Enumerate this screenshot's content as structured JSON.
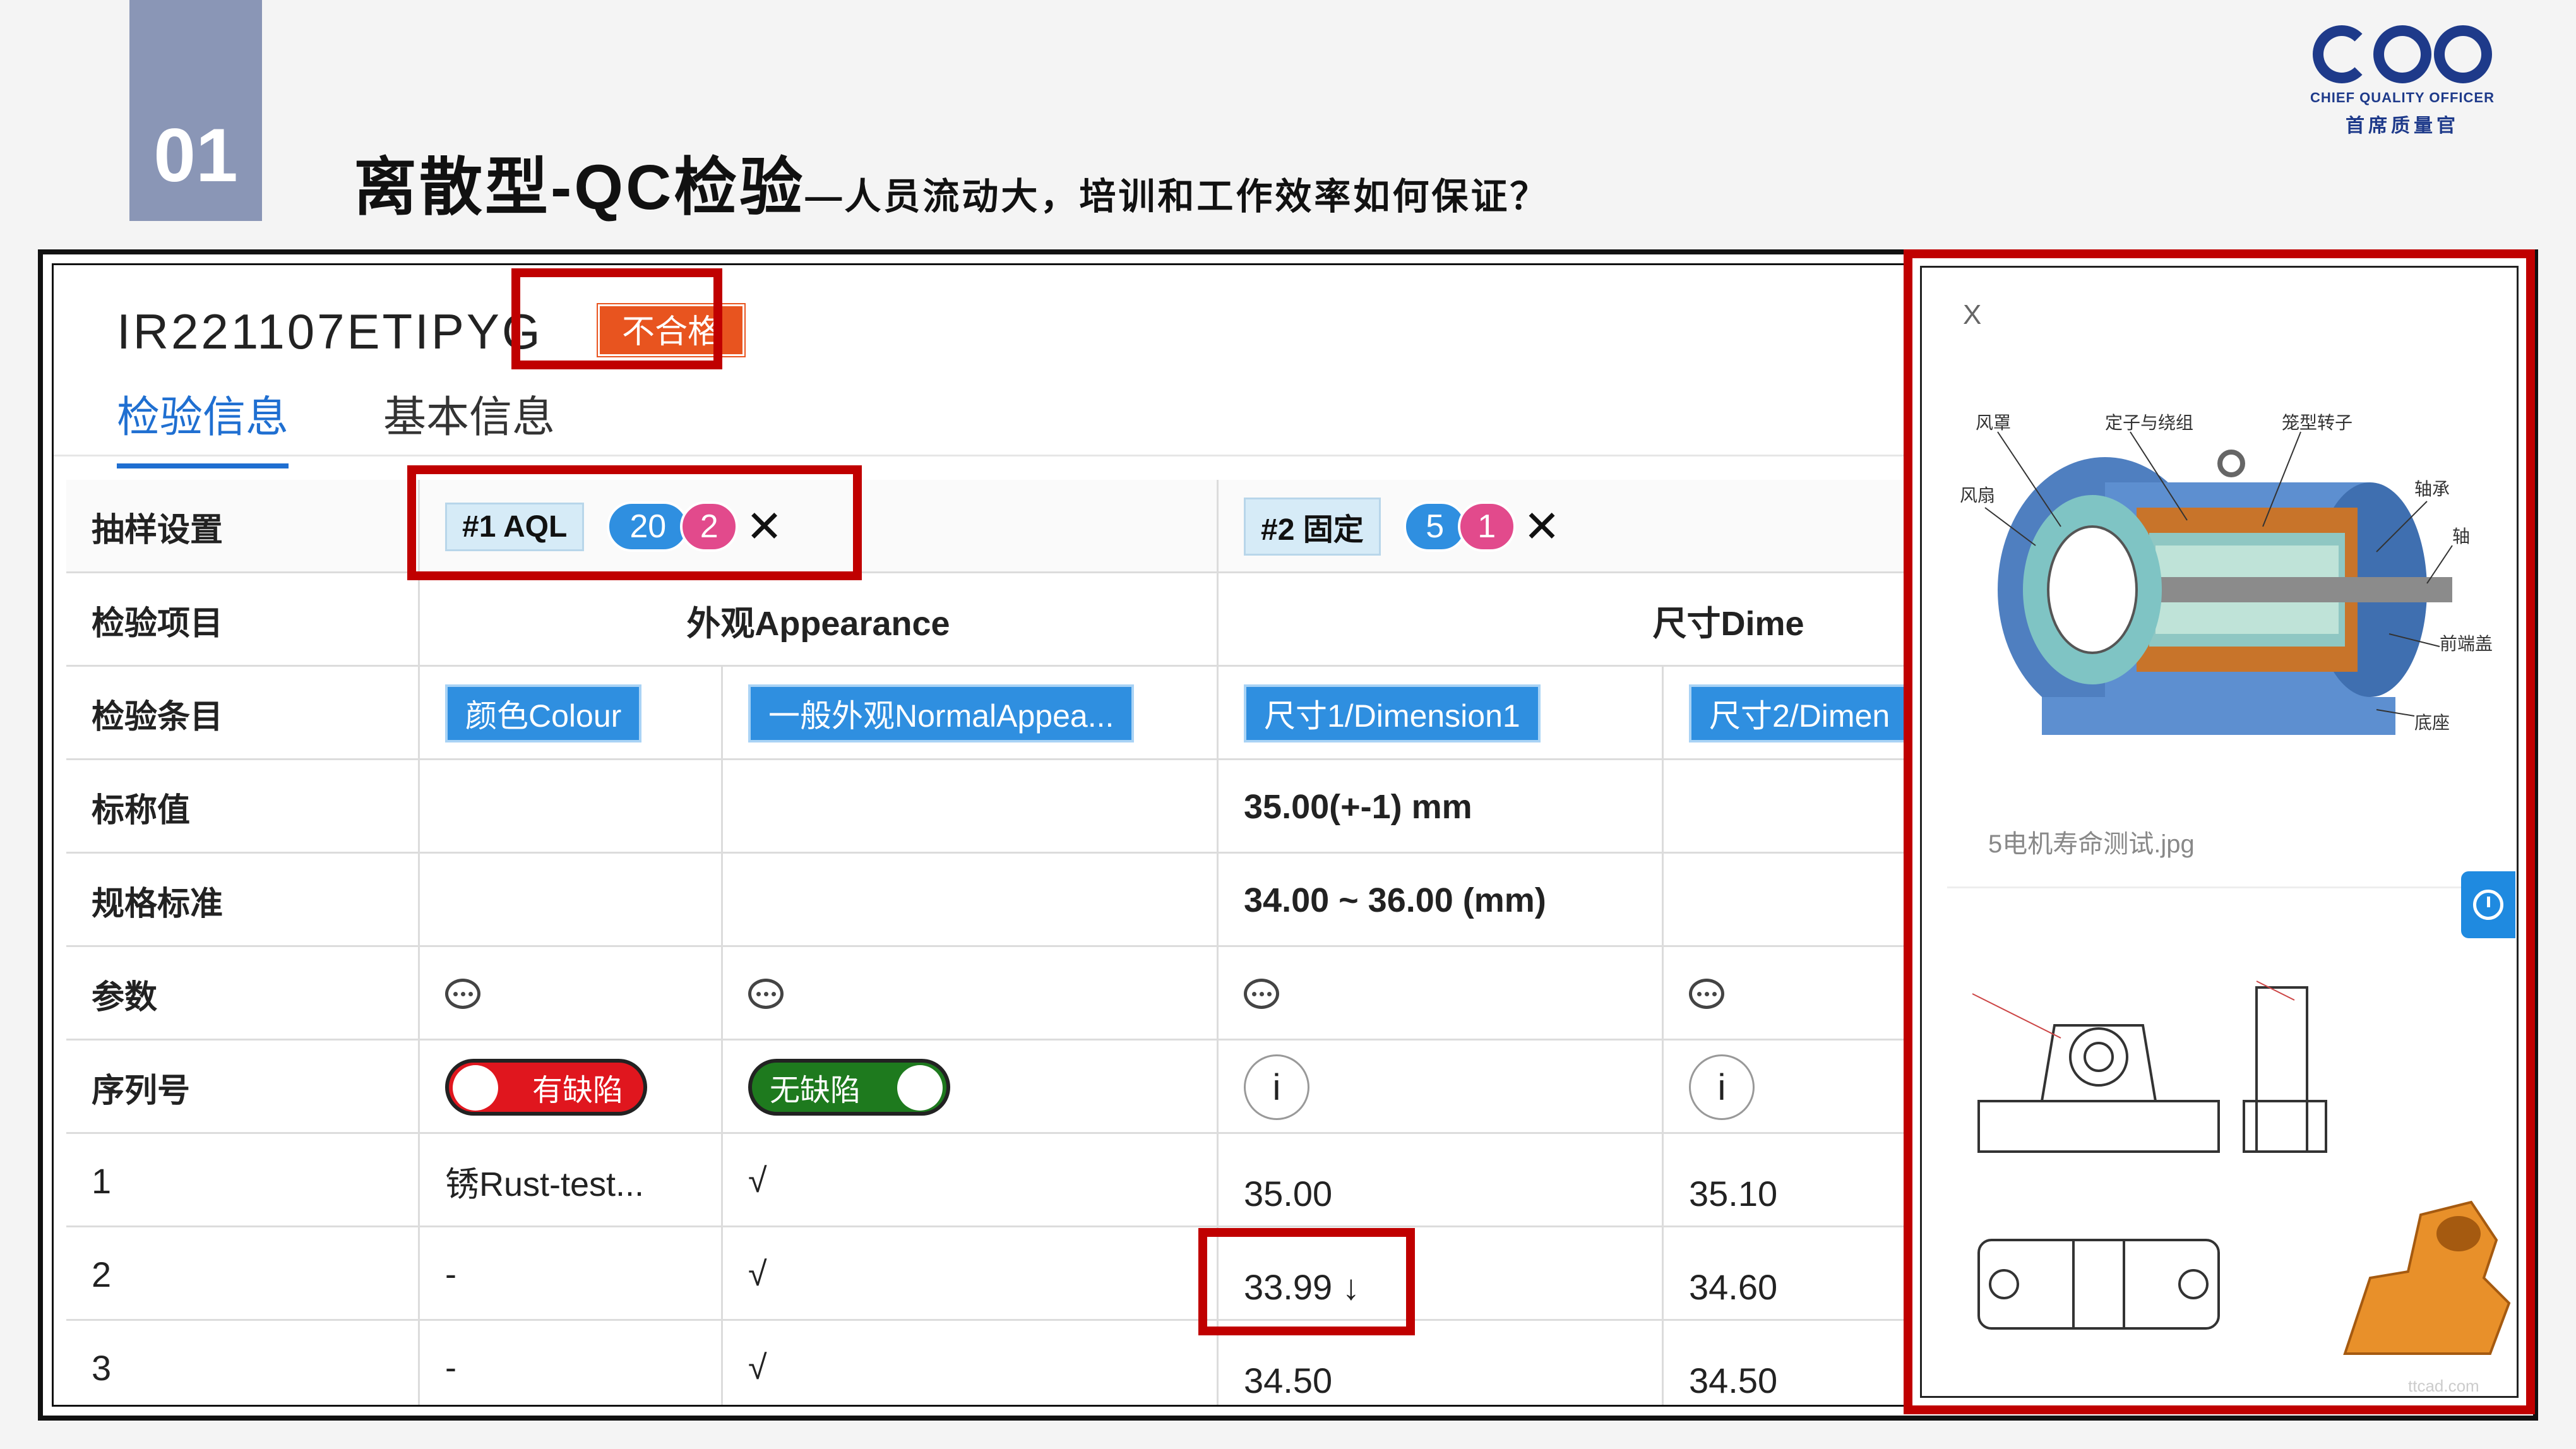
{
  "slide": {
    "number": "01",
    "title_main": "离散型-QC检验",
    "title_sub": "—人员流动大，培训和工作效率如何保证？",
    "logo": {
      "mark": "CQO",
      "en": "CHIEF QUALITY OFFICER",
      "cn": "首席质量官"
    }
  },
  "report": {
    "id": "IR221107ETIPYG",
    "status_badge": "不合格",
    "tabs": [
      "检验信息",
      "基本信息"
    ],
    "active_tab": 0
  },
  "table": {
    "row_labels": {
      "sampling": "抽样设置",
      "item": "检验项目",
      "entry": "检验条目",
      "nominal": "标称值",
      "spec": "规格标准",
      "params": "参数",
      "serial": "序列号"
    },
    "sampling": [
      {
        "label": "#1 AQL",
        "count": "20",
        "defects": "2"
      },
      {
        "label": "#2 固定",
        "count": "5",
        "defects": "1"
      }
    ],
    "items": [
      "外观Appearance",
      "尺寸Dime"
    ],
    "entries": [
      "颜色Colour",
      "一般外观NormalAppea...",
      "尺寸1/Dimension1",
      "尺寸2/Dimen"
    ],
    "nominal": {
      "dimension1": "35.00(+-1) mm"
    },
    "spec": {
      "dimension1": "34.00 ~ 36.00 (mm)"
    },
    "serial_toggles": {
      "defect_on": "有缺陷",
      "defect_off": "无缺陷",
      "info": "i"
    },
    "rows": [
      {
        "no": "1",
        "colour": "锈Rust-test...",
        "appearance": "√",
        "dim1": "35.00",
        "dim2": "35.10"
      },
      {
        "no": "2",
        "colour": "-",
        "appearance": "√",
        "dim1": "33.99",
        "dim1_flag": "↓",
        "dim2": "34.60"
      },
      {
        "no": "3",
        "colour": "-",
        "appearance": "√",
        "dim1": "34.50",
        "dim2": "34.50"
      }
    ]
  },
  "image_panel": {
    "close": "X",
    "caption": "5电机寿命测试.jpg",
    "motor_labels": [
      "风罩",
      "定子与绕组",
      "笼型转子",
      "风扇",
      "轴承",
      "轴",
      "前端盖",
      "底座"
    ],
    "watermark": "ttcad.com",
    "colors": {
      "highlight": "#c00000",
      "accent": "#1f6fd1",
      "fail": "#e8541f"
    }
  }
}
